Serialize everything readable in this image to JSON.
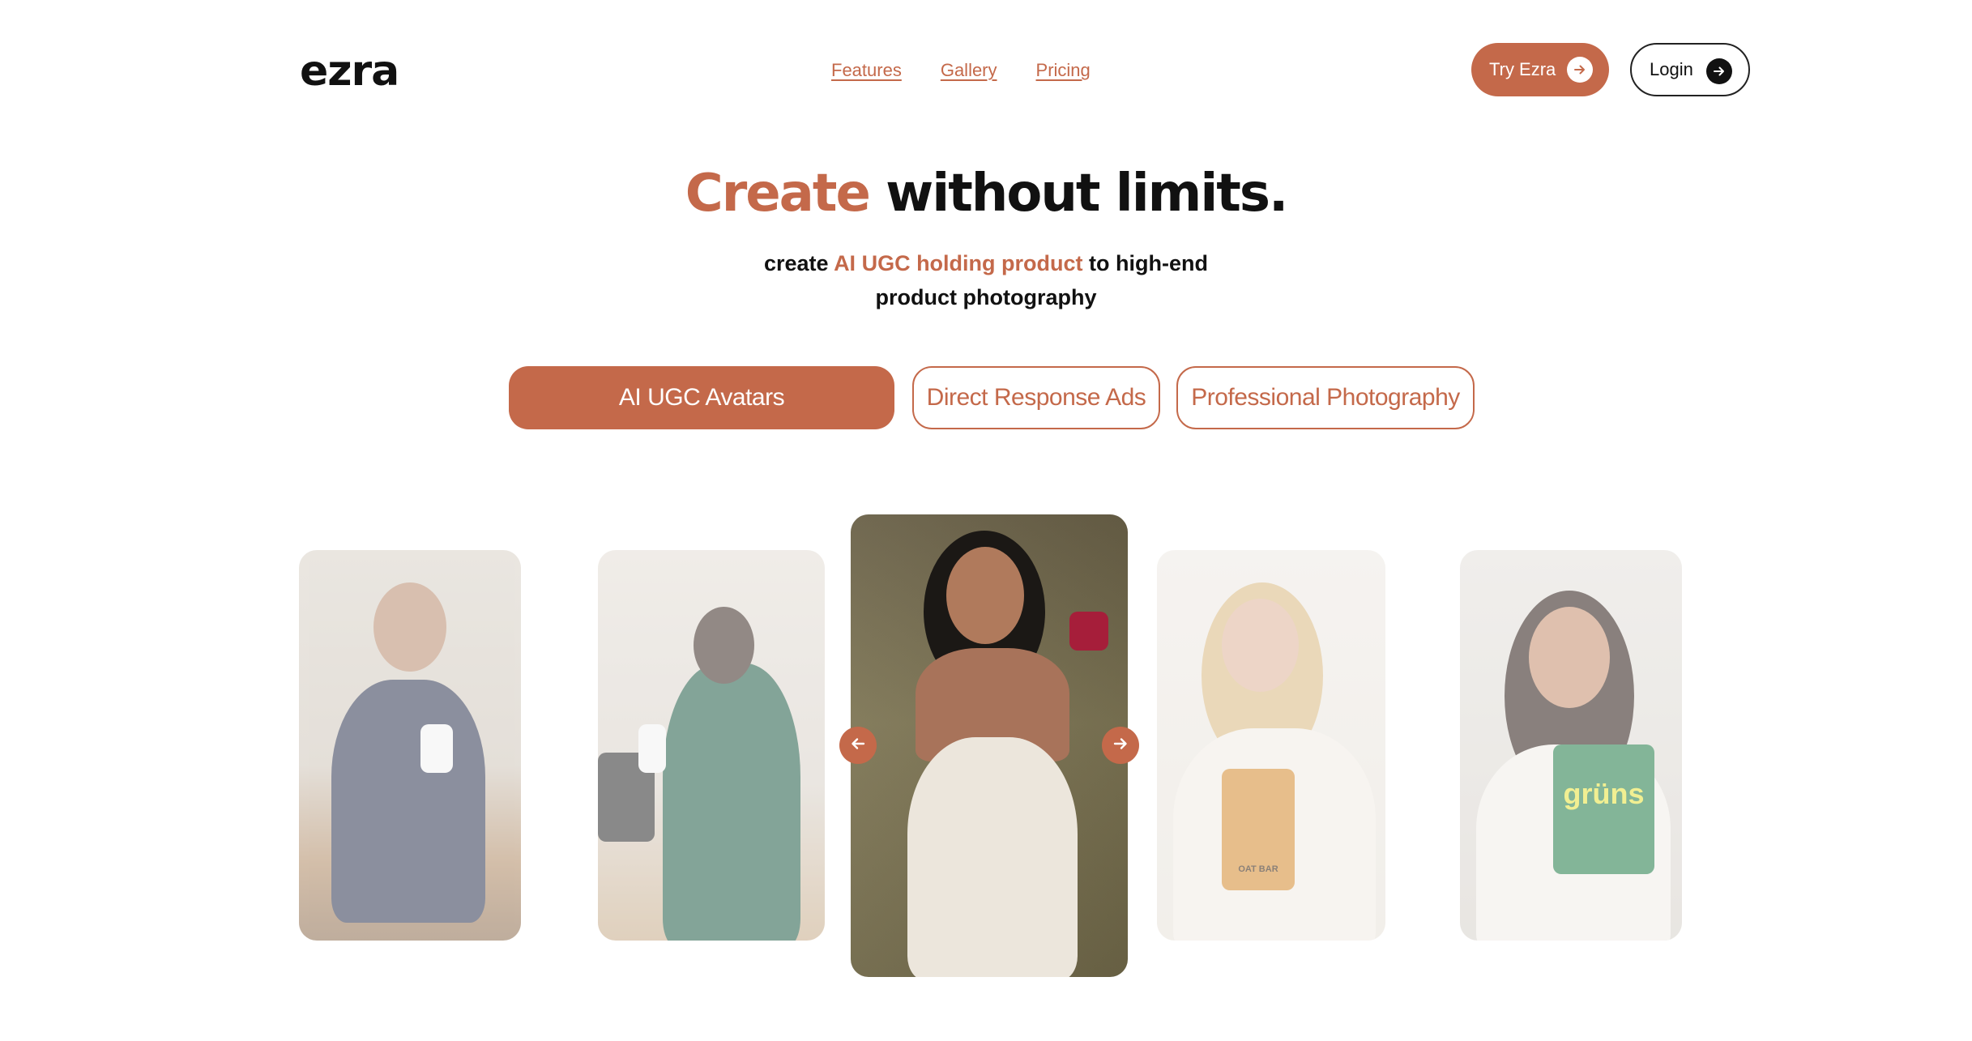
{
  "brand": {
    "logo": "ezra",
    "accent_color": "#c4694a"
  },
  "nav": {
    "items": [
      "Features",
      "Gallery",
      "Pricing"
    ]
  },
  "header": {
    "try_label": "Try Ezra",
    "login_label": "Login"
  },
  "hero": {
    "title_accent": "Create",
    "title_rest": " without limits.",
    "subtitle_pre": "create ",
    "subtitle_accent": "AI UGC holding product",
    "subtitle_post": " to high-end",
    "subtitle_line2": "product photography"
  },
  "tabs": [
    {
      "label": "AI UGC Avatars",
      "active": true
    },
    {
      "label": "Direct Response Ads",
      "active": false
    },
    {
      "label": "Professional Photography",
      "active": false
    }
  ],
  "carousel": {
    "prev_icon": "arrow-left-icon",
    "next_icon": "arrow-right-icon",
    "active_index": 2,
    "slides": [
      {
        "subject": "man holding supplement bottle",
        "faded": true
      },
      {
        "subject": "woman in green dress holding bottle",
        "faded": true
      },
      {
        "subject": "woman in towel with soap bar",
        "faded": false
      },
      {
        "subject": "woman holding oat bar package",
        "faded": true
      },
      {
        "subject": "woman holding gruns pouch",
        "faded": true
      }
    ],
    "slide5_package_text": "grüns",
    "slide4_package_text": "OAT BAR"
  }
}
